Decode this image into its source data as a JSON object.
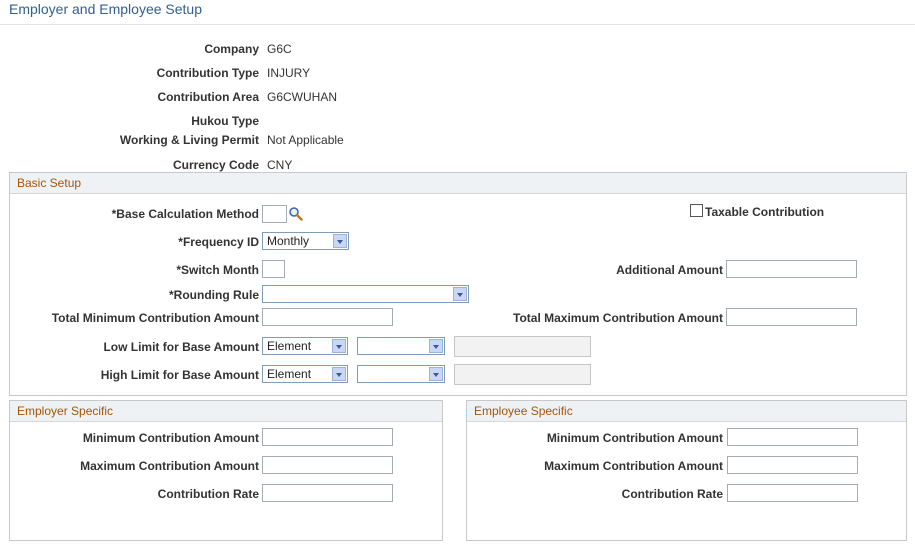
{
  "page": {
    "title": "Employer and Employee Setup"
  },
  "info": {
    "company_label": "Company",
    "company_value": "G6C",
    "contribution_type_label": "Contribution Type",
    "contribution_type_value": "INJURY",
    "contribution_area_label": "Contribution Area",
    "contribution_area_value": "G6CWUHAN",
    "hukou_type_label": "Hukou Type",
    "hukou_type_value": "",
    "permit_label": "Working & Living Permit",
    "permit_value": "Not Applicable",
    "currency_label": "Currency Code",
    "currency_value": "CNY"
  },
  "basic_setup": {
    "title": "Basic Setup",
    "base_calc_label": "*Base Calculation Method",
    "base_calc_value": "",
    "taxable_label": "Taxable Contribution",
    "taxable_checked": false,
    "frequency_label": "*Frequency ID",
    "frequency_value": "Monthly",
    "switch_month_label": "*Switch Month",
    "switch_month_value": "",
    "additional_amount_label": "Additional Amount",
    "additional_amount_value": "",
    "rounding_label": "*Rounding Rule",
    "rounding_value": "",
    "total_min_label": "Total Minimum Contribution Amount",
    "total_min_value": "",
    "total_max_label": "Total Maximum Contribution Amount",
    "total_max_value": "",
    "low_limit_label": "Low Limit for Base Amount",
    "low_limit_type": "Element",
    "low_limit_sub": "",
    "low_limit_value": "",
    "high_limit_label": "High Limit for Base Amount",
    "high_limit_type": "Element",
    "high_limit_sub": "",
    "high_limit_value": ""
  },
  "employer": {
    "title": "Employer Specific",
    "min_label": "Minimum Contribution Amount",
    "min_value": "",
    "max_label": "Maximum Contribution Amount",
    "max_value": "",
    "rate_label": "Contribution Rate",
    "rate_value": ""
  },
  "employee": {
    "title": "Employee Specific",
    "min_label": "Minimum Contribution Amount",
    "min_value": "",
    "max_label": "Maximum Contribution Amount",
    "max_value": "",
    "rate_label": "Contribution Rate",
    "rate_value": ""
  },
  "icons": {
    "lookup": "magnifier-icon",
    "dropdown": "chevron-down-icon"
  }
}
